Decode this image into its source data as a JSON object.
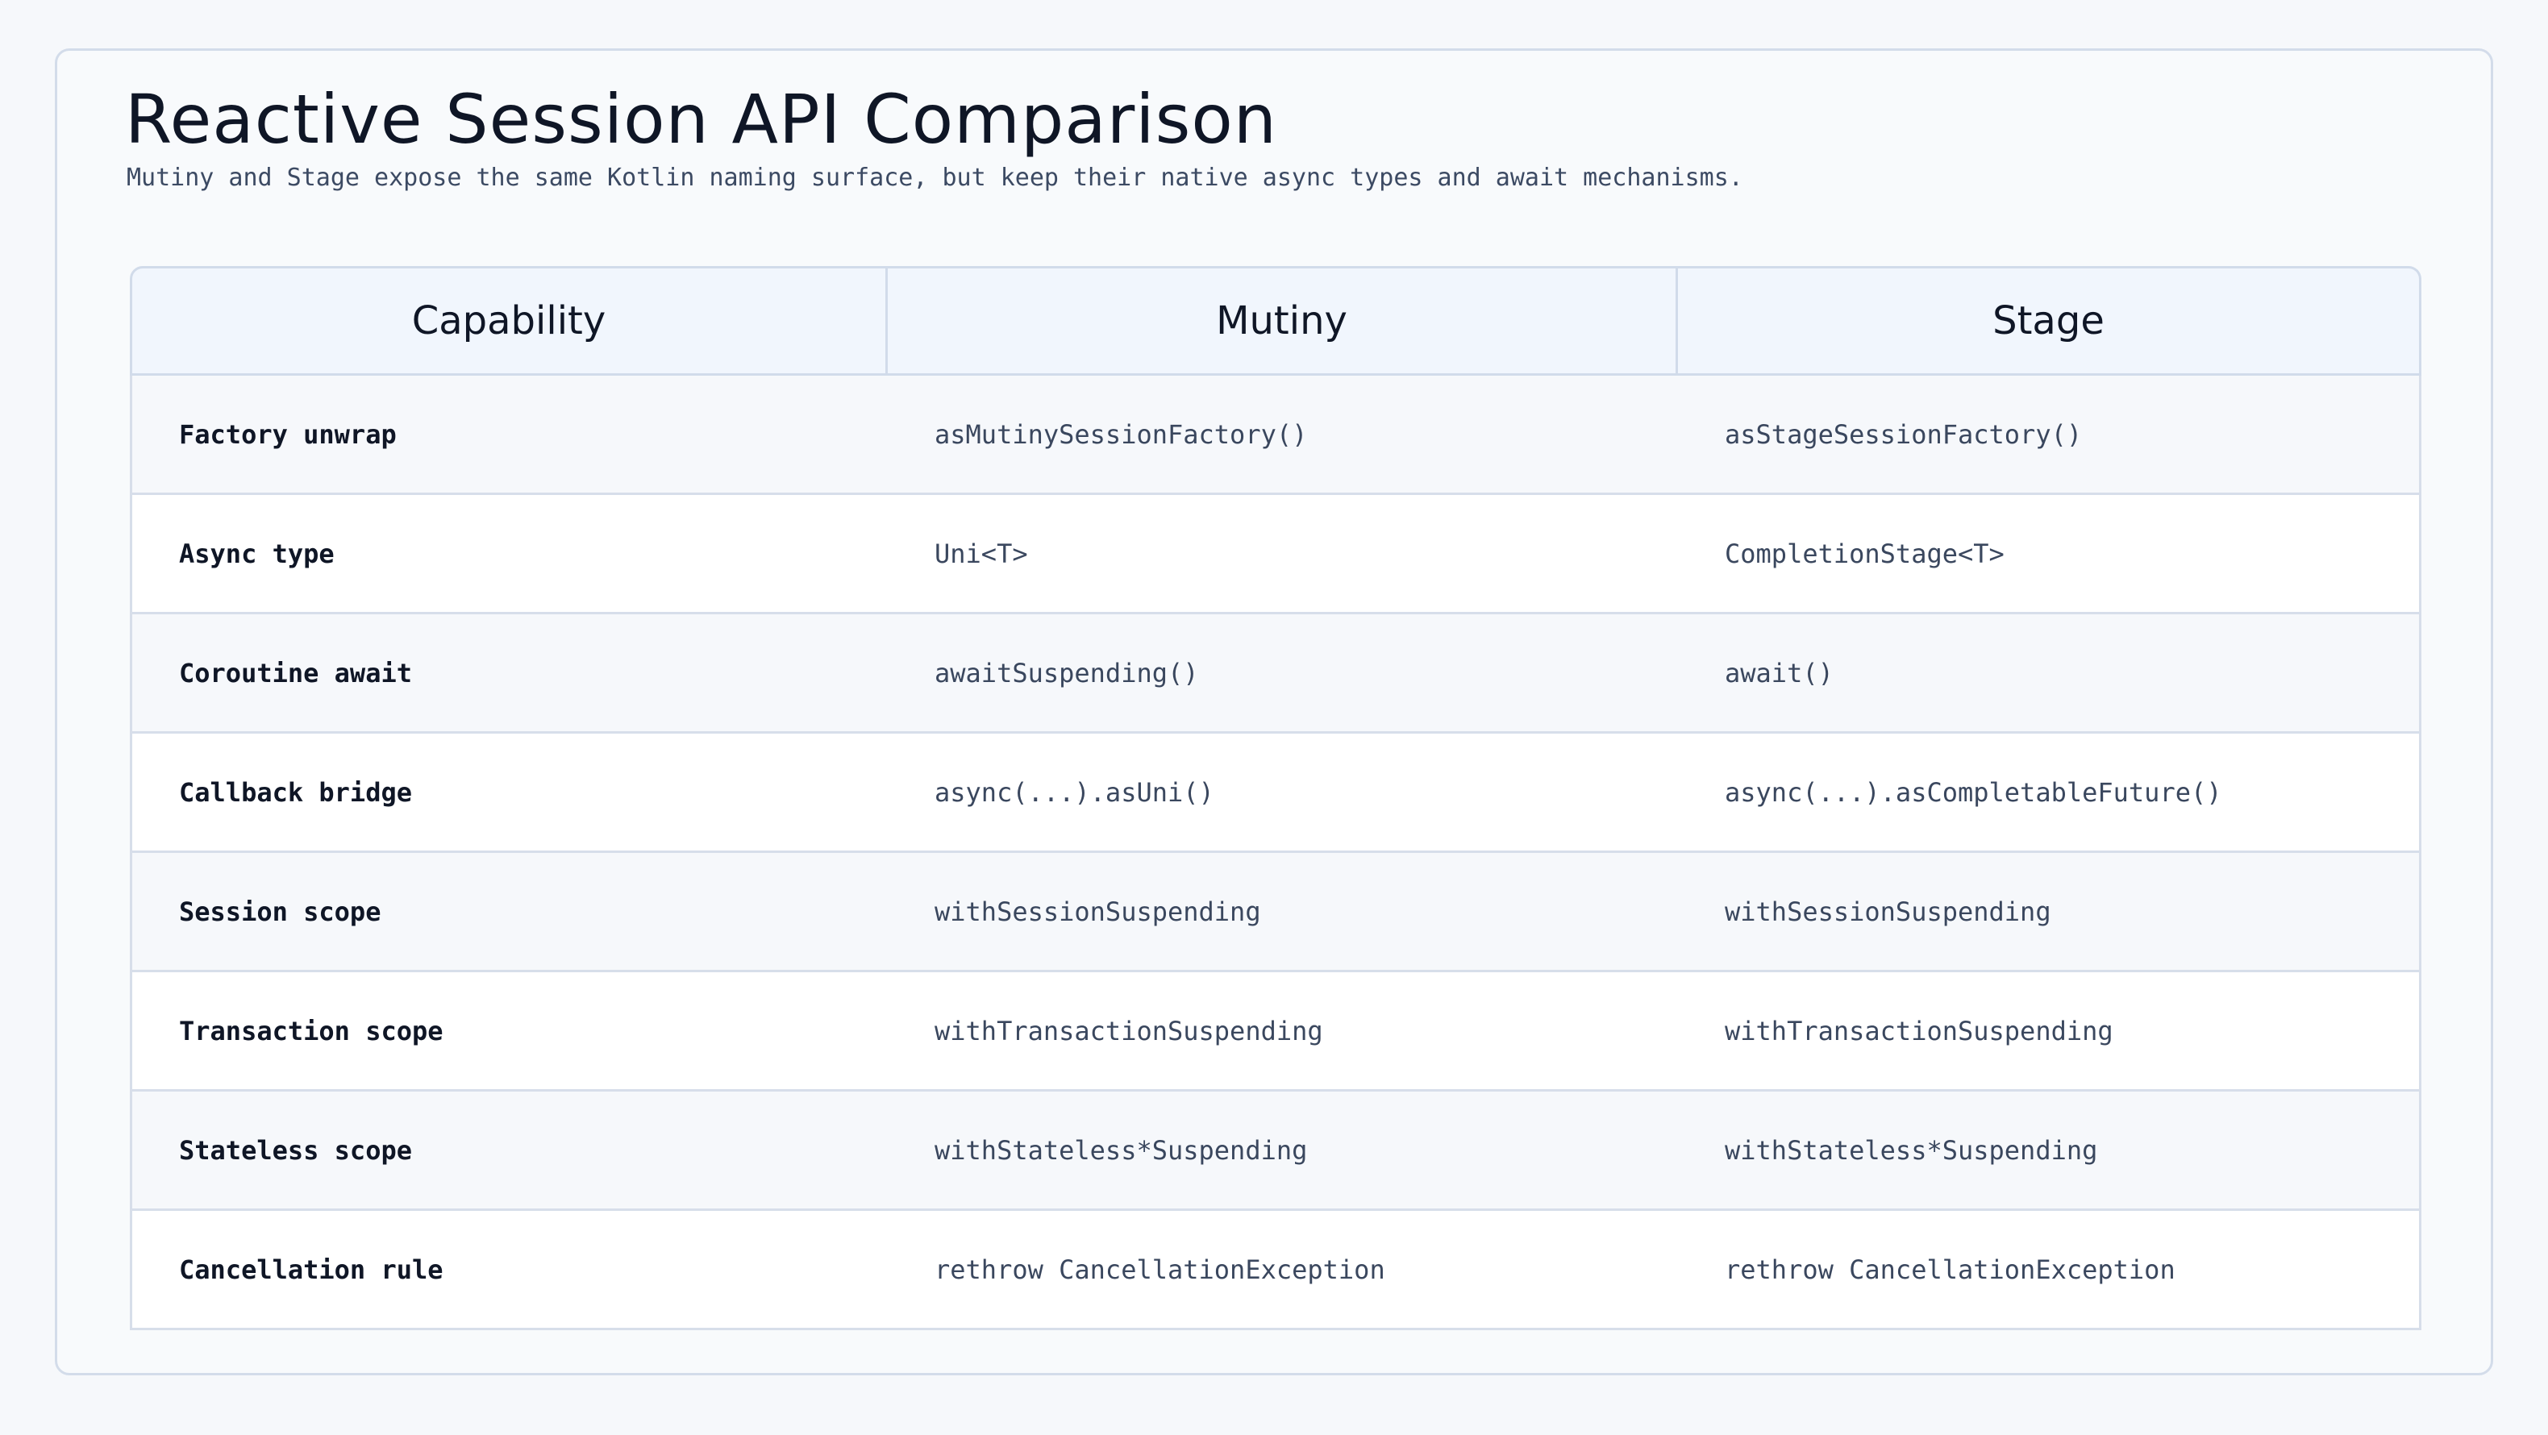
{
  "title": "Reactive Session API Comparison",
  "subtitle": "Mutiny and Stage expose the same Kotlin naming surface, but keep their native async types and await mechanisms.",
  "table": {
    "headers": [
      "Capability",
      "Mutiny",
      "Stage"
    ],
    "rows": [
      [
        "Factory unwrap",
        "asMutinySessionFactory()",
        "asStageSessionFactory()"
      ],
      [
        "Async type",
        "Uni<T>",
        "CompletionStage<T>"
      ],
      [
        "Coroutine await",
        "awaitSuspending()",
        "await()"
      ],
      [
        "Callback bridge",
        "async(...).asUni()",
        "async(...).asCompletableFuture()"
      ],
      [
        "Session scope",
        "withSessionSuspending",
        "withSessionSuspending"
      ],
      [
        "Transaction scope",
        "withTransactionSuspending",
        "withTransactionSuspending"
      ],
      [
        "Stateless scope",
        "withStateless*Suspending",
        "withStateless*Suspending"
      ],
      [
        "Cancellation rule",
        "rethrow CancellationException",
        "rethrow CancellationException"
      ]
    ]
  }
}
